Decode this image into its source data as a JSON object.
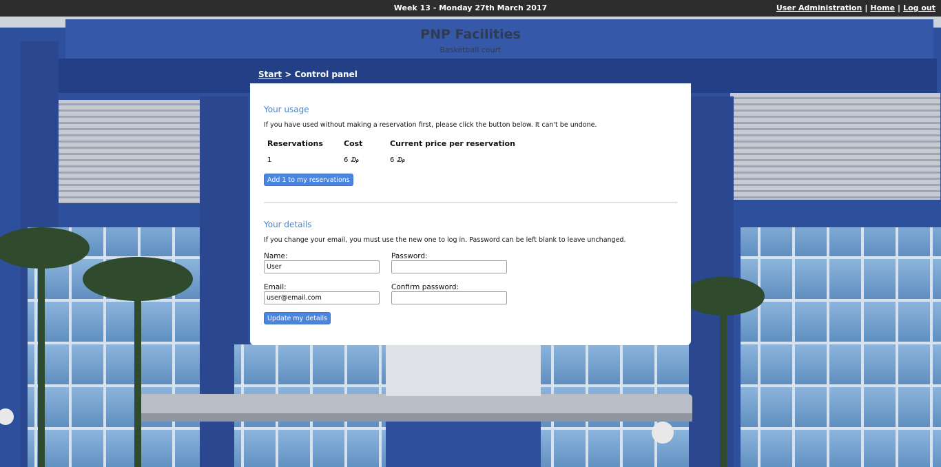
{
  "topbar": {
    "date": "Week 13 - Monday 27th March 2017",
    "links": [
      "User Administration",
      "Home",
      "Log out"
    ],
    "separator": "|"
  },
  "header": {
    "title": "PNP Facilities",
    "subtitle": "Basketball court"
  },
  "breadcrumb": {
    "start": "Start",
    "separator": ">",
    "current": "Control panel"
  },
  "usage": {
    "title": "Your usage",
    "note": "If you have used without making a reservation first, please click the button below. It can't be undone.",
    "columns": [
      "Reservations",
      "Cost",
      "Current price per reservation"
    ],
    "row": [
      "1",
      "6 ₯",
      "6 ₯"
    ],
    "button": "Add 1 to my reservations"
  },
  "details": {
    "title": "Your details",
    "note": "If you change your email, you must use the new one to log in. Password can be left blank to leave unchanged.",
    "name_label": "Name:",
    "name_value": "User",
    "password_label": "Password:",
    "password_value": "",
    "email_label": "Email:",
    "email_value": "user@email.com",
    "confirm_label": "Confirm password:",
    "confirm_value": "",
    "button": "Update my details"
  },
  "colors": {
    "topbar": "#2d2d2d",
    "accent": "#4a86c8",
    "button": "#4a86e0",
    "building_blue": "#2e4f9c"
  }
}
